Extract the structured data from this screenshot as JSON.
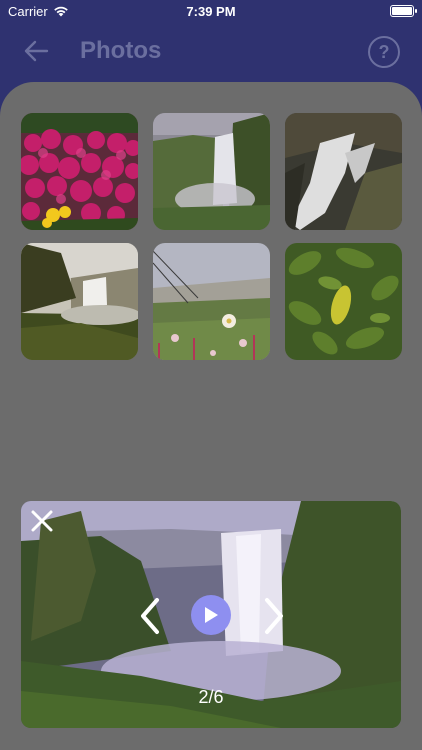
{
  "status_bar": {
    "carrier": "Carrier",
    "time": "7:39 PM"
  },
  "nav": {
    "title": "Photos",
    "back_icon": "arrow-left-icon",
    "help_label": "?"
  },
  "photos": [
    {
      "subject": "pink flowers"
    },
    {
      "subject": "waterfall cliff"
    },
    {
      "subject": "cascade closeup"
    },
    {
      "subject": "waterfall canyon"
    },
    {
      "subject": "grassy hillside"
    },
    {
      "subject": "green leaves"
    }
  ],
  "viewer": {
    "counter": "2/6",
    "play_color": "#8e8ff0"
  },
  "colors": {
    "nav_bg": "#2f3270",
    "sheet_bg": "#6c6c6c",
    "nav_text": "#6b6f9f"
  }
}
